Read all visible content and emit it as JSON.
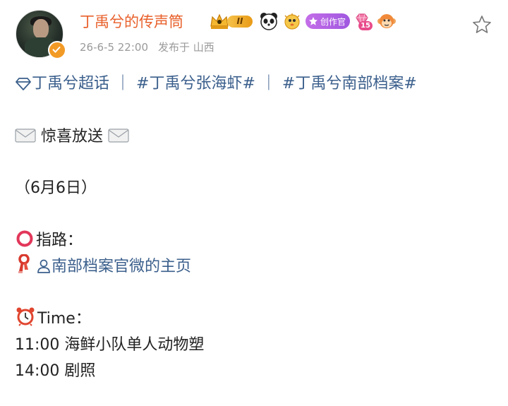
{
  "post": {
    "username": "丁禹兮的传声筒",
    "level_badge": "II",
    "creator_badge": "创作官",
    "lv_number": "15",
    "timestamp": "26-6-5 22:00",
    "source": "发布于 山西"
  },
  "content": {
    "tags": {
      "super_topic": "丁禹兮超话",
      "tag1": "#丁禹兮张海虾#",
      "tag2": "#丁禹兮南部档案#",
      "separator": "｜"
    },
    "headline": "惊喜放送",
    "date_line": "（6月6日）",
    "guide_label": "指路：",
    "guide_link": "南部档案官微的主页",
    "time_label": "Time：",
    "schedule": [
      "11:00 海鲜小队单人动物塑",
      "14:00 剧照"
    ]
  },
  "icons": {
    "verify": "verified-orange-icon",
    "follow": "star-outline-icon",
    "super_topic": "diamond-icon",
    "circle": "red-circle-emoji",
    "scarf": "scarf-emoji",
    "user": "user-outline-icon",
    "clock": "alarm-clock-emoji",
    "envelope": "envelope-emoji"
  },
  "colors": {
    "username": "#e8612c",
    "link": "#3b5f8c",
    "meta": "#9a9a9a"
  }
}
